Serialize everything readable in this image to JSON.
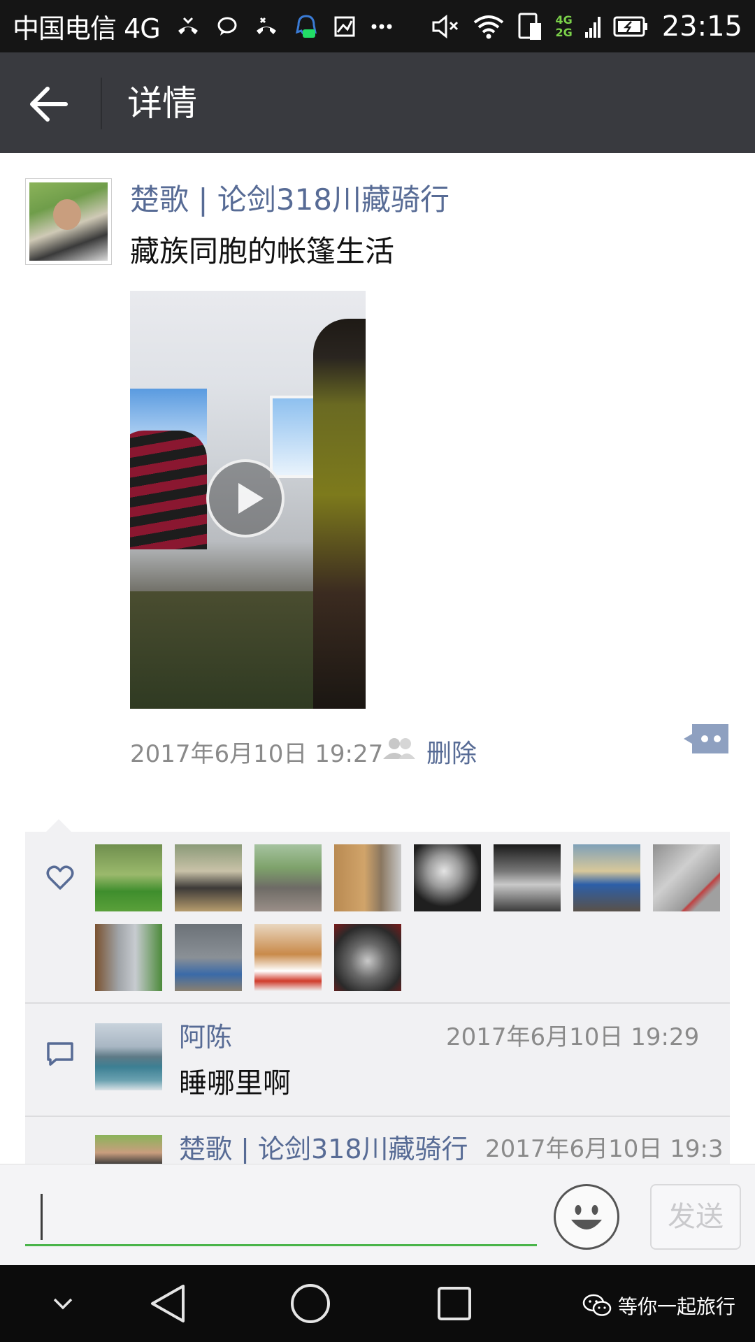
{
  "status_bar": {
    "carrier": "中国电信 4G",
    "network_top": "4G",
    "network_bottom": "2G",
    "time": "23:15"
  },
  "header": {
    "title": "详情",
    "back_icon": "arrow-left-icon"
  },
  "post": {
    "author": "楚歌 | 论剑318川藏骑行",
    "text": "藏族同胞的帐篷生活",
    "media": "video",
    "timestamp": "2017年6月10日 19:27",
    "delete_label": "删除"
  },
  "likes": {
    "icon": "heart-icon",
    "count_shown": 12
  },
  "comments": [
    {
      "name": "阿陈",
      "time": "2017年6月10日 19:29",
      "text": "睡哪里啊"
    },
    {
      "name": "楚歌 | 论剑318川藏骑行",
      "time": "2017年6月10日 19:3"
    }
  ],
  "input": {
    "value": "",
    "send_label": "发送"
  },
  "watermark": {
    "text": "等你一起旅行"
  },
  "colors": {
    "link": "#576b95",
    "title_bar": "#393a3f",
    "input_underline": "#4ab44a"
  }
}
